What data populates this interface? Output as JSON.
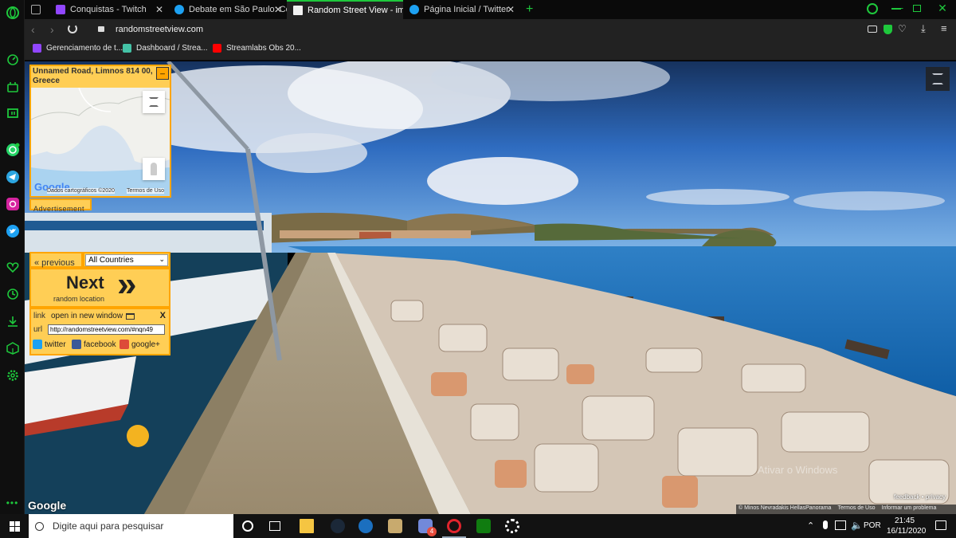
{
  "browser": {
    "tabs": [
      {
        "label": "",
        "color": "#6a6a6a"
      },
      {
        "label": "Conquistas - Twitch",
        "color": "#9146ff"
      },
      {
        "label": "Debate em São Paulo: Cova",
        "color": "#1da1f2"
      },
      {
        "label": "Random Street View - imag",
        "color": "#f2f2f2"
      },
      {
        "label": "Página Inicial / Twitter",
        "color": "#1da1f2"
      }
    ],
    "url": "randomstreetview.com",
    "bookmarks": [
      {
        "label": "Gerenciamento de t...",
        "color": "#9146ff"
      },
      {
        "label": "Dashboard / Strea...",
        "color": "#44c2a6"
      },
      {
        "label": "Streamlabs Obs 20...",
        "color": "#ff0000"
      }
    ]
  },
  "page": {
    "address": "Unnamed Road, Limnos 814 00, Greece",
    "minimize_label": "_",
    "map_credit": "Dados cartográficos ©2020",
    "map_terms": "Termos de Uso",
    "map_google": "Google",
    "advertisement": "Advertisement",
    "previous": "« previous",
    "country_select": "All Countries",
    "next_label": "Next",
    "next_chevrons": "»",
    "next_sub": "random location",
    "link_label": "link",
    "open_new_window": "open in new window",
    "close_x": "X",
    "url_label": "url",
    "url_value": "http://randomstreetview.com/#nqn49",
    "share": {
      "twitter": "twitter",
      "facebook": "facebook",
      "googleplus": "google+"
    },
    "google_logo": "Google",
    "watermark": "Ativar o Windows",
    "feedback": "feedback • privacy",
    "credits": [
      "© Minos Nevradakis HellasPanorama",
      "Termos de Uso",
      "Informar um problema"
    ]
  },
  "taskbar": {
    "search_placeholder": "Digite aqui para pesquisar",
    "lang": "POR",
    "time": "21:45",
    "date": "16/11/2020",
    "notif_badge": "4"
  },
  "colors": {
    "accent": "#1ec83c",
    "panel": "#ffce55",
    "panel_border": "#ffa500"
  }
}
